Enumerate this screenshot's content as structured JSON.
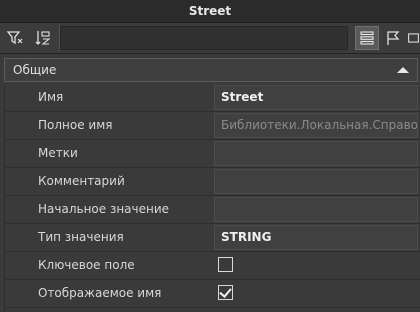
{
  "window": {
    "title": "Street"
  },
  "toolbar": {
    "filter_icon": "filter-icon",
    "sort_icon": "sort-icon",
    "list_view_icon": "list-view-icon",
    "flag_icon": "flag-icon",
    "search_value": ""
  },
  "section": {
    "title": "Общие",
    "expanded": true
  },
  "properties": [
    {
      "label": "Имя",
      "value": "Street"
    },
    {
      "label": "Полное имя",
      "value": "Библиотеки.Локальная.Справочни"
    },
    {
      "label": "Метки",
      "value": ""
    },
    {
      "label": "Комментарий",
      "value": ""
    },
    {
      "label": "Начальное значение",
      "value": ""
    },
    {
      "label": "Тип значения",
      "value": "STRING"
    },
    {
      "label": "Ключевое поле",
      "checked": false
    },
    {
      "label": "Отображаемое имя",
      "checked": true
    }
  ]
}
